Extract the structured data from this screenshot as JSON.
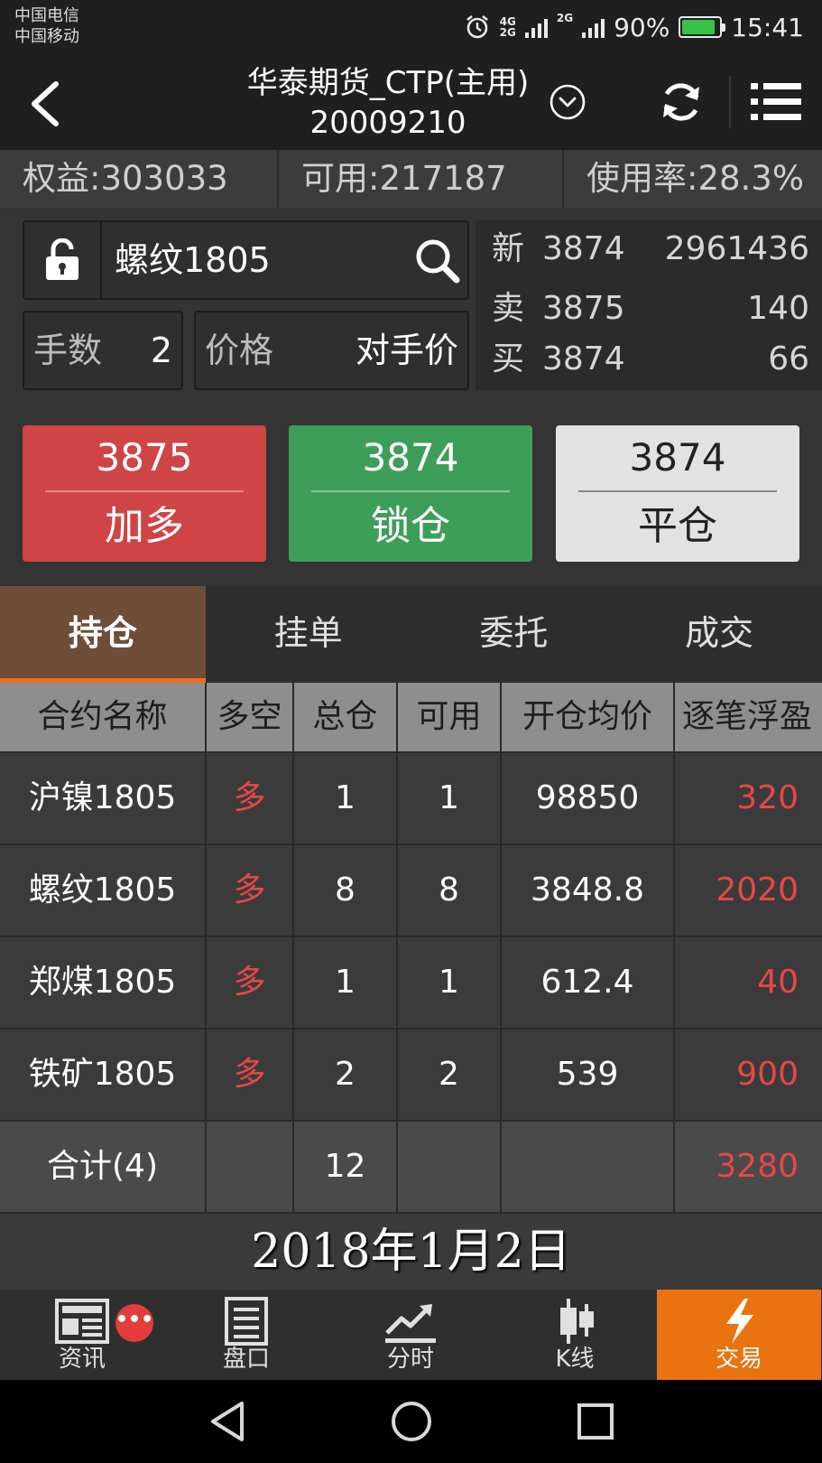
{
  "status_bar": {
    "carrier_1": "中国电信",
    "carrier_2": "中国移动",
    "network_1": "4G",
    "network_2": "2G",
    "network_3": "2G",
    "battery": "90%",
    "battery_percent": 90,
    "time": "15:41",
    "icons": [
      "alarm-icon",
      "signal-icon",
      "battery-charging-icon"
    ]
  },
  "header": {
    "title": "华泰期货_CTP(主用)",
    "account_id": "20009210",
    "icons": [
      "back-arrow-icon",
      "chevron-down-circle-icon",
      "refresh-icon",
      "menu-list-icon"
    ]
  },
  "account_summary": {
    "equity": "权益:303033",
    "available": "可用:217187",
    "usage": "使用率:28.3%"
  },
  "order_panel": {
    "contract": "螺纹1805",
    "qty_label": "手数",
    "qty_value": "2",
    "price_label": "价格",
    "price_value": "对手价",
    "icons": [
      "unlock-icon",
      "search-icon"
    ]
  },
  "quote": {
    "last": {
      "label": "新",
      "price": "3874",
      "volume": "2961436"
    },
    "ask": {
      "label": "卖",
      "price": "3875",
      "volume": "140"
    },
    "bid": {
      "label": "买",
      "price": "3874",
      "volume": "66"
    }
  },
  "actions": {
    "buy": {
      "price": "3875",
      "label": "加多"
    },
    "lock": {
      "price": "3874",
      "label": "锁仓"
    },
    "close": {
      "price": "3874",
      "label": "平仓"
    }
  },
  "tabs": [
    "持仓",
    "挂单",
    "委托",
    "成交"
  ],
  "positions": {
    "headers": [
      "合约名称",
      "多空",
      "总仓",
      "可用",
      "开仓均价",
      "逐笔浮盈"
    ],
    "rows": [
      [
        "沪镍1805",
        "多",
        "1",
        "1",
        "98850",
        "320"
      ],
      [
        "螺纹1805",
        "多",
        "8",
        "8",
        "3848.8",
        "2020"
      ],
      [
        "郑煤1805",
        "多",
        "1",
        "1",
        "612.4",
        "40"
      ],
      [
        "铁矿1805",
        "多",
        "2",
        "2",
        "539",
        "900"
      ]
    ],
    "total": {
      "name": "合计(4)",
      "side": "",
      "total": "12",
      "available": "",
      "avg": "",
      "pnl": "3280"
    }
  },
  "date_overlay": "2018年1月2日",
  "bottom_nav": {
    "items": [
      "资讯",
      "盘口",
      "分时",
      "K线",
      "交易"
    ],
    "badge": "•••",
    "icons": [
      "news-icon",
      "order-book-icon",
      "intraday-chart-icon",
      "candlestick-icon",
      "lightning-icon"
    ]
  },
  "colors": {
    "buy": "#cf4444",
    "lock": "#3d9e5a",
    "close": "#e2e2e2",
    "accent": "#e9730f",
    "profit": "#e84747"
  }
}
